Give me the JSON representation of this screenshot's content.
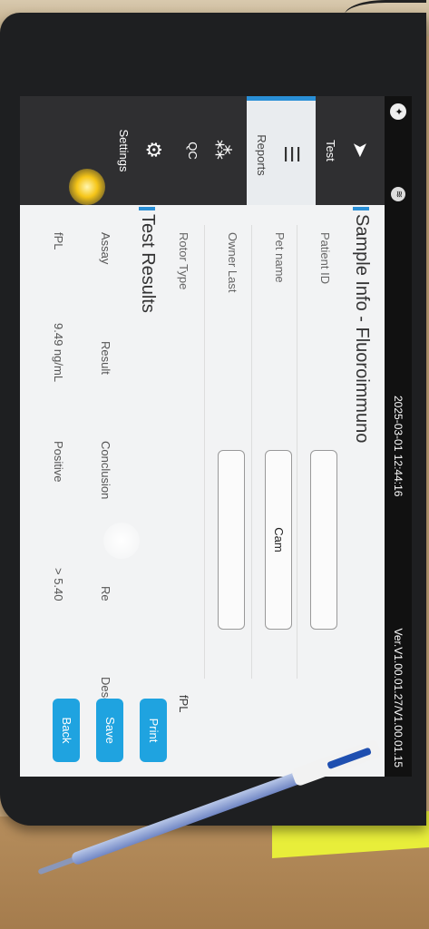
{
  "status": {
    "datetime": "2025-03-01 12:44:16",
    "version": "Ver.V1.00.01.27/V1.00.01.15"
  },
  "nav": {
    "test": "Test",
    "reports": "Reports",
    "qc": "QC",
    "settings": "Settings",
    "active": "reports"
  },
  "sample": {
    "title": "Sample Info - Fluoroimmuno",
    "patient_id_label": "Patient ID",
    "patient_id_value": "",
    "pet_name_label": "Pet name",
    "pet_name_value": "Cam",
    "owner_last_label": "Owner Last",
    "owner_last_value": "",
    "rotor_type_label": "Rotor Type",
    "rotor_type_value": "fPL"
  },
  "results": {
    "title": "Test Results",
    "headers": [
      "Assay",
      "Result",
      "Conclusion",
      "Re",
      "Descr."
    ],
    "rows": [
      {
        "assay": "fPL",
        "result": "9.49 ng/mL",
        "conclusion": "Positive",
        "ref": "> 5.40",
        "descr": ""
      }
    ]
  },
  "buttons": {
    "print": "Print",
    "save": "Save",
    "back": "Back"
  },
  "icons": {
    "test": "test-arrow-icon",
    "reports": "reports-list-icon",
    "qc": "qc-nodes-icon",
    "settings": "gear-icon"
  },
  "colors": {
    "accent": "#2a8fd6",
    "button": "#1fa3e0",
    "nav_bg": "#2f2f31"
  }
}
